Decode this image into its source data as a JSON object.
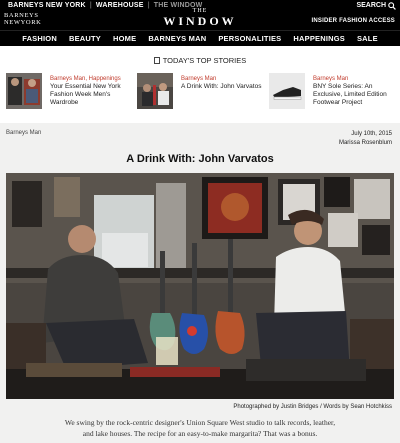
{
  "header": {
    "top_links": [
      "BARNEYS NEW YORK",
      "WAREHOUSE",
      "THE WINDOW"
    ],
    "brand_logo_line1": "BARNEYS",
    "brand_logo_line2": "NEWYORK",
    "wordmark_the": "THE",
    "wordmark_window": "WINDOW",
    "search_label": "SEARCH",
    "insider_label": "INSIDER FASHION ACCESS",
    "nav": [
      "FASHION",
      "BEAUTY",
      "HOME",
      "BARNEYS MAN",
      "PERSONALITIES",
      "HAPPENINGS",
      "SALE"
    ]
  },
  "top_stories": {
    "label": "TODAY'S TOP STORIES",
    "items": [
      {
        "category": "Barneys Man, Happenings",
        "title": "Your Essential New York Fashion Week Men's Wardrobe"
      },
      {
        "category": "Barneys Man",
        "title": "A Drink With: John Varvatos"
      },
      {
        "category": "Barneys Man",
        "title": "BNY Sole Series: An Exclusive, Limited Edition Footwear Project"
      }
    ]
  },
  "article": {
    "breadcrumb": "Barneys Man",
    "date": "July 10th, 2015",
    "author": "Marissa Rosenblum",
    "headline": "A Drink With: John Varvatos",
    "photo_credit": "Photographed by Justin Bridges / Words by Sean Hotchkiss",
    "dek_line1": "We swing by the rock-centric designer's Union Square West studio to talk records, leather,",
    "dek_line2": "and lake houses. The recipe for an easy-to-make margarita? That was a bonus."
  },
  "colors": {
    "header_bg": "#000000",
    "category_red": "#c03a2b",
    "article_bg": "#f1f1f0"
  }
}
